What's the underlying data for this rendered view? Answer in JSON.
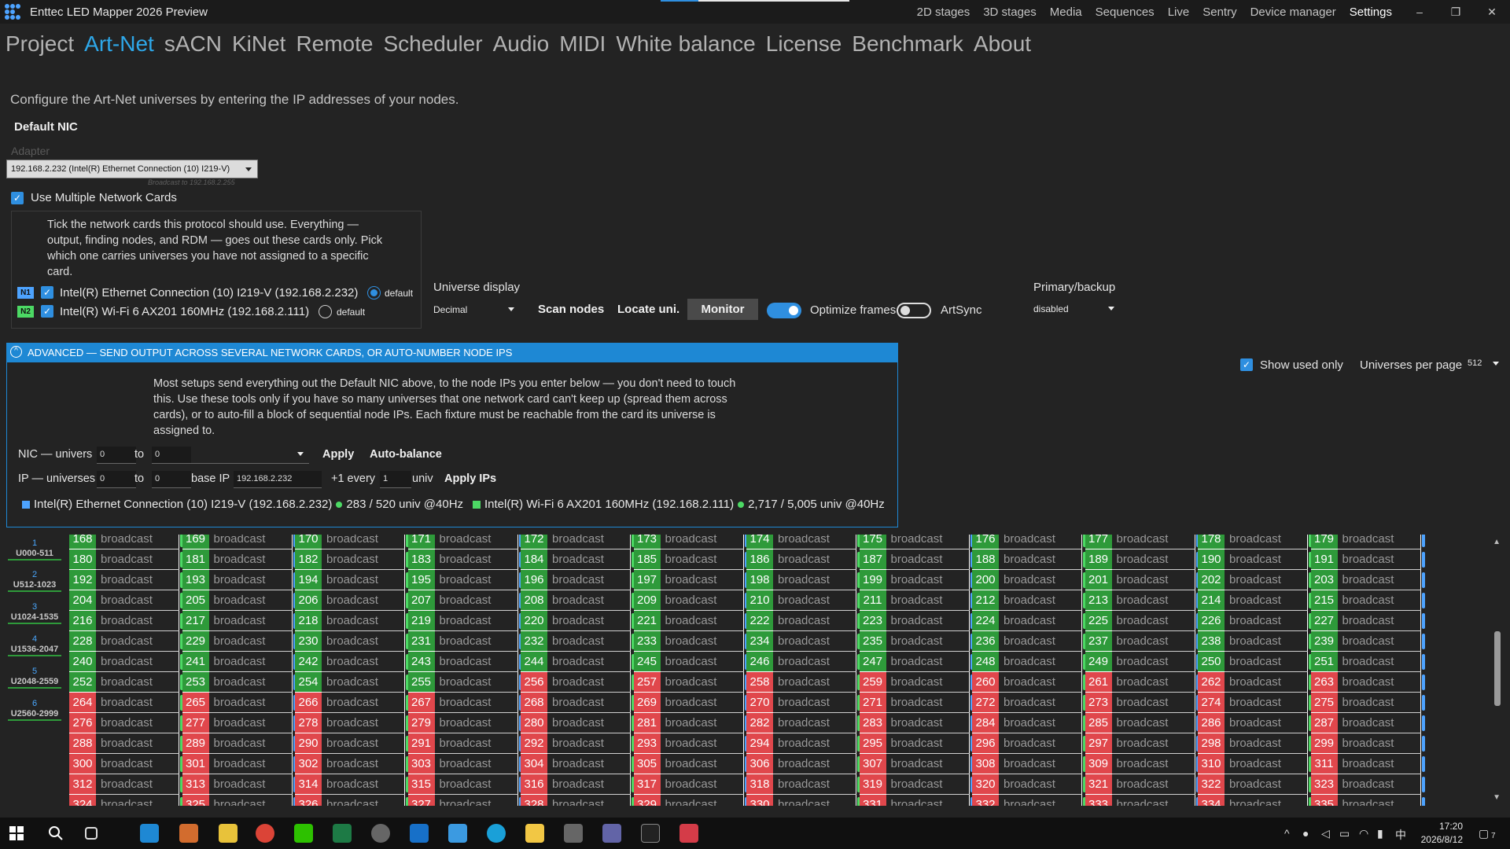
{
  "window": {
    "title": "Enttec LED Mapper 2026 Preview"
  },
  "menu": [
    "2D stages",
    "3D stages",
    "Media",
    "Sequences",
    "Live",
    "Sentry",
    "Device manager",
    "Settings"
  ],
  "tabs": [
    "Project",
    "Art-Net",
    "sACN",
    "KiNet",
    "Remote",
    "Scheduler",
    "Audio",
    "MIDI",
    "White balance",
    "License",
    "Benchmark",
    "About"
  ],
  "intro": "Configure the Art-Net universes by entering the IP addresses of your nodes.",
  "default_nic": {
    "title": "Default NIC",
    "adapter_label": "Adapter",
    "adapter_value": "192.168.2.232 (Intel(R) Ethernet Connection (10) I219-V)",
    "broadcast_note": "Broadcast to 192.168.2.255"
  },
  "multi": {
    "label": "Use Multiple Network Cards",
    "checked": true,
    "help": "Tick the network cards this protocol should use. Everything — output, finding nodes, and RDM — goes out these cards only. Pick which one carries universes you have not assigned to a specific card.",
    "cards": [
      {
        "tag": "N1",
        "tag_color": "#4da3ff",
        "label": "Intel(R) Ethernet Connection (10) I219-V (192.168.2.232)",
        "default_label": "default",
        "is_default": true
      },
      {
        "tag": "N2",
        "tag_color": "#4cd964",
        "label": "Intel(R) Wi-Fi 6 AX201 160MHz (192.168.2.111)",
        "default_label": "default",
        "is_default": false
      }
    ]
  },
  "toolbar": {
    "universe_display_label": "Universe display",
    "universe_display_value": "Decimal",
    "scan_nodes": "Scan nodes",
    "locate": "Locate uni.",
    "monitor": "Monitor",
    "optimize_label": "Optimize frames",
    "optimize_on": true,
    "artsync_label": "ArtSync",
    "artsync_on": false,
    "primary_backup_label": "Primary/backup",
    "primary_backup_value": "disabled"
  },
  "view": {
    "show_used_only": "Show used only",
    "per_page_label": "Universes per page",
    "per_page_value": "512"
  },
  "advanced": {
    "header": "ADVANCED — SEND OUTPUT ACROSS SEVERAL NETWORK CARDS, OR AUTO-NUMBER NODE IPS",
    "help": "Most setups send everything out the Default NIC above, to the node IPs you enter below — you don't need to touch this. Use these tools only if you have so many universes that one network card can't keep up (spread them across cards), or to auto-fill a block of sequential node IPs. Each fixture must be reachable from the card its universe is assigned to.",
    "nic_label": "NIC — univers",
    "nic_from": "0",
    "to": "to",
    "nic_to": "0",
    "apply": "Apply",
    "auto_balance": "Auto-balance",
    "ip_label": "IP — universes",
    "ip_from": "0",
    "ip_to": "0",
    "base_ip_label": "base IP",
    "base_ip": "192.168.2.232",
    "plus_every": "+1 every",
    "every_value": "1",
    "univ": "univ",
    "apply_ips": "Apply IPs",
    "card_stats": [
      {
        "color": "#4da3ff",
        "label": "Intel(R) Ethernet Connection (10) I219-V (192.168.2.232)",
        "stats": "283 / 520 univ @40Hz"
      },
      {
        "color": "#4cd964",
        "label": "Intel(R) Wi-Fi 6 AX201 160MHz (192.168.2.111)",
        "stats": "2,717 / 5,005 univ @40Hz"
      }
    ]
  },
  "universe_pages": [
    {
      "n": "1",
      "range": "U000-511"
    },
    {
      "n": "2",
      "range": "U512-1023"
    },
    {
      "n": "3",
      "range": "U1024-1535"
    },
    {
      "n": "4",
      "range": "U1536-2047"
    },
    {
      "n": "5",
      "range": "U2048-2559"
    },
    {
      "n": "6",
      "range": "U2560-2999"
    }
  ],
  "grid": {
    "cell_text": "broadcast",
    "first_visible": 168,
    "columns": 12,
    "rows": 14,
    "red_from": 264,
    "partial_green_from": 252,
    "partial_green_cols": 4,
    "colors": {
      "green": "#2e9a3a",
      "red": "#e0474c",
      "blue_stripe": "#4da3ff",
      "green_stripe": "#4cd964"
    }
  },
  "clock": {
    "time": "17:20",
    "date": "2026/8/12"
  },
  "notify_count": "7"
}
